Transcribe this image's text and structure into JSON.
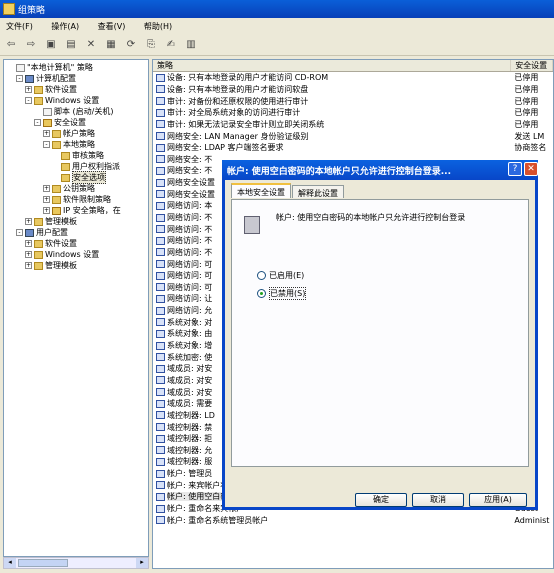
{
  "window": {
    "title": "组策略"
  },
  "menu": [
    "文件(F)",
    "操作(A)",
    "查看(V)",
    "帮助(H)"
  ],
  "tree": [
    {
      "label": "\"本地计算机\" 策略",
      "indent": 0,
      "icon": "doc",
      "pm": ""
    },
    {
      "label": "计算机配置",
      "indent": 1,
      "icon": "pc",
      "pm": "-"
    },
    {
      "label": "软件设置",
      "indent": 2,
      "icon": "folder",
      "pm": "+"
    },
    {
      "label": "Windows 设置",
      "indent": 2,
      "icon": "folder",
      "pm": "-"
    },
    {
      "label": "脚本 (启动/关机)",
      "indent": 3,
      "icon": "doc",
      "pm": ""
    },
    {
      "label": "安全设置",
      "indent": 3,
      "icon": "sh",
      "pm": "-"
    },
    {
      "label": "帐户策略",
      "indent": 4,
      "icon": "folder",
      "pm": "+"
    },
    {
      "label": "本地策略",
      "indent": 4,
      "icon": "folder",
      "pm": "-"
    },
    {
      "label": "审核策略",
      "indent": 5,
      "icon": "folder",
      "pm": ""
    },
    {
      "label": "用户权利指派",
      "indent": 5,
      "icon": "folder",
      "pm": ""
    },
    {
      "label": "安全选项",
      "indent": 5,
      "icon": "folder",
      "pm": "",
      "selected": true
    },
    {
      "label": "公钥策略",
      "indent": 4,
      "icon": "folder",
      "pm": "+"
    },
    {
      "label": "软件限制策略",
      "indent": 4,
      "icon": "folder",
      "pm": "+"
    },
    {
      "label": "IP 安全策略，在",
      "indent": 4,
      "icon": "sh",
      "pm": "+"
    },
    {
      "label": "管理模板",
      "indent": 2,
      "icon": "folder",
      "pm": "+"
    },
    {
      "label": "用户配置",
      "indent": 1,
      "icon": "pc",
      "pm": "-"
    },
    {
      "label": "软件设置",
      "indent": 2,
      "icon": "folder",
      "pm": "+"
    },
    {
      "label": "Windows 设置",
      "indent": 2,
      "icon": "folder",
      "pm": "+"
    },
    {
      "label": "管理模板",
      "indent": 2,
      "icon": "folder",
      "pm": "+"
    }
  ],
  "list": {
    "headers": [
      "策略",
      "安全设置"
    ],
    "rows": [
      {
        "policy": "设备: 只有本地登录的用户才能访问 CD-ROM",
        "setting": "已停用"
      },
      {
        "policy": "设备: 只有本地登录的用户才能访问软盘",
        "setting": "已停用"
      },
      {
        "policy": "审计: 对备份和还原权限的使用进行审计",
        "setting": "已停用"
      },
      {
        "policy": "审计: 对全局系统对象的访问进行审计",
        "setting": "已停用"
      },
      {
        "policy": "审计: 如果无法记录安全审计则立即关闭系统",
        "setting": "已停用"
      },
      {
        "policy": "网络安全: LAN Manager 身份验证级别",
        "setting": "发送 LM"
      },
      {
        "policy": "网络安全: LDAP 客户端签名要求",
        "setting": "协商签名"
      },
      {
        "policy": "网络安全: 不",
        "setting": ""
      },
      {
        "policy": "网络安全: 不",
        "setting": ""
      },
      {
        "policy": "网络安全设置",
        "setting": "小"
      },
      {
        "policy": "网络安全设置",
        "setting": "小"
      },
      {
        "policy": "网络访问: 本",
        "setting": ""
      },
      {
        "policy": "网络访问: 不",
        "setting": "一"
      },
      {
        "policy": "网络访问: 不",
        "setting": ""
      },
      {
        "policy": "网络访问: 不",
        "setting": ""
      },
      {
        "policy": "网络访问: 不",
        "setting": ""
      },
      {
        "policy": "网络访问: 可",
        "setting": "g, D"
      },
      {
        "policy": "网络访问: 可",
        "setting": "P, C"
      },
      {
        "policy": "网络访问: 可",
        "setting": "n\\C"
      },
      {
        "policy": "网络访问: 让",
        "setting": ""
      },
      {
        "policy": "网络访问: 允",
        "setting": ""
      },
      {
        "policy": "系统对象: 对",
        "setting": ""
      },
      {
        "policy": "系统对象: 由",
        "setting": "t c"
      },
      {
        "policy": "系统对象: 增",
        "setting": ""
      },
      {
        "policy": "系统加密: 使",
        "setting": ""
      },
      {
        "policy": "域成员: 对安",
        "setting": ""
      },
      {
        "policy": "域成员: 对安",
        "setting": ""
      },
      {
        "policy": "域成员: 对安",
        "setting": ""
      },
      {
        "policy": "域成员: 需要",
        "setting": ""
      },
      {
        "policy": "域控制器: LD",
        "setting": "定义"
      },
      {
        "policy": "域控制器: 禁",
        "setting": "定义"
      },
      {
        "policy": "域控制器: 拒",
        "setting": "定义"
      },
      {
        "policy": "域控制器: 允",
        "setting": "定义"
      },
      {
        "policy": "域控制器: 服",
        "setting": "定义"
      },
      {
        "policy": "帐户: 管理员",
        "setting": ""
      },
      {
        "policy": "帐户: 来宾帐户状态",
        "setting": "已停用"
      },
      {
        "policy": "帐户: 使用空白密码的本地帐户只允许进行控制台登录",
        "setting": "已启用",
        "highlight": true
      },
      {
        "policy": "帐户: 重命名来宾帐户",
        "setting": "Guest"
      },
      {
        "policy": "帐户: 重命名系统管理员帐户",
        "setting": "Administ"
      }
    ]
  },
  "dialog": {
    "title": "帐户: 使用空白密码的本地帐户只允许进行控制台登录...",
    "help_glyph": "?",
    "close_glyph": "✕",
    "tabs": [
      "本地安全设置",
      "解释此设置"
    ],
    "description": "帐户: 使用空白密码的本地帐户只允许进行控制台登录",
    "options": [
      {
        "label": "已启用(E)",
        "checked": false
      },
      {
        "label": "已禁用(S)",
        "checked": true
      }
    ],
    "buttons": {
      "ok": "确定",
      "cancel": "取消",
      "apply": "应用(A)"
    }
  }
}
